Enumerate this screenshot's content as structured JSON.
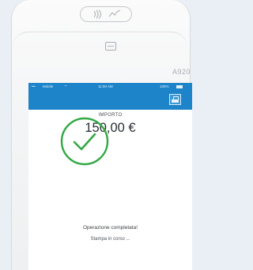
{
  "device": {
    "model": "A920"
  },
  "status_bar": {
    "carrier": "Mobile",
    "time": "11:00 AM",
    "battery": "100%"
  },
  "payment": {
    "label": "IMPORTO",
    "amount": "150,00 €",
    "message": "Operazione completata!",
    "sub_message": "Stampa in corso ..."
  },
  "colors": {
    "accent": "#1d84c9",
    "success": "#33a845"
  }
}
